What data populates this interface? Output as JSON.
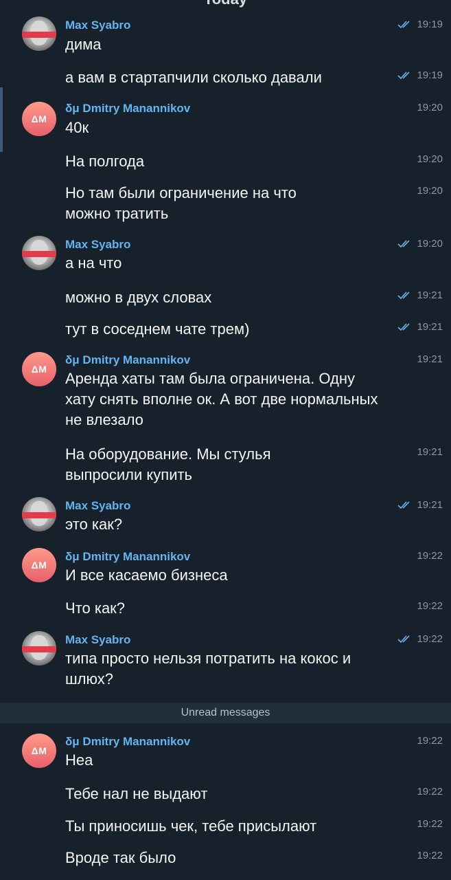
{
  "date_header": "Today",
  "unread_label": "Unread messages",
  "senders": {
    "max": "Max Syabro",
    "dmitry": "δμ Dmitry Manannikov",
    "dmitry_initials": "ΔM"
  },
  "messages": [
    {
      "text": "дима",
      "time": "19:19"
    },
    {
      "text": "а вам в стартапчили сколько давали",
      "time": "19:19"
    },
    {
      "text": "40к",
      "time": "19:20"
    },
    {
      "text": "На полгода",
      "time": "19:20"
    },
    {
      "text": "Но там были ограничение на что можно тратить",
      "time": "19:20"
    },
    {
      "text": "а на что",
      "time": "19:20"
    },
    {
      "text": "можно в двух словах",
      "time": "19:21"
    },
    {
      "text": "тут в соседнем чате трем)",
      "time": "19:21"
    },
    {
      "text": "Аренда хаты там была ограничена. Одну хату снять вполне ок. А вот две нормальных не влезало",
      "time": "19:21"
    },
    {
      "text": "На оборудование. Мы стулья выпросили купить",
      "time": "19:21"
    },
    {
      "text": "это как?",
      "time": "19:21"
    },
    {
      "text": "И все касаемо бизнеса",
      "time": "19:22"
    },
    {
      "text": "Что как?",
      "time": "19:22"
    },
    {
      "text": "типа просто нельзя потратить на кокос и шлюх?",
      "time": "19:22"
    },
    {
      "text": "Неа",
      "time": "19:22"
    },
    {
      "text": "Тебе нал не выдают",
      "time": "19:22"
    },
    {
      "text": "Ты приносишь чек, тебе присылают",
      "time": "19:22"
    },
    {
      "text": "Вроде так было",
      "time": "19:22"
    }
  ],
  "colors": {
    "background": "#17212b",
    "sender_name": "#64b5ef",
    "read_check": "#64b5ef",
    "timestamp": "#8b98a5",
    "unread_bar": "#232e3c"
  },
  "icons": {
    "read_receipt": "double-check-icon"
  }
}
